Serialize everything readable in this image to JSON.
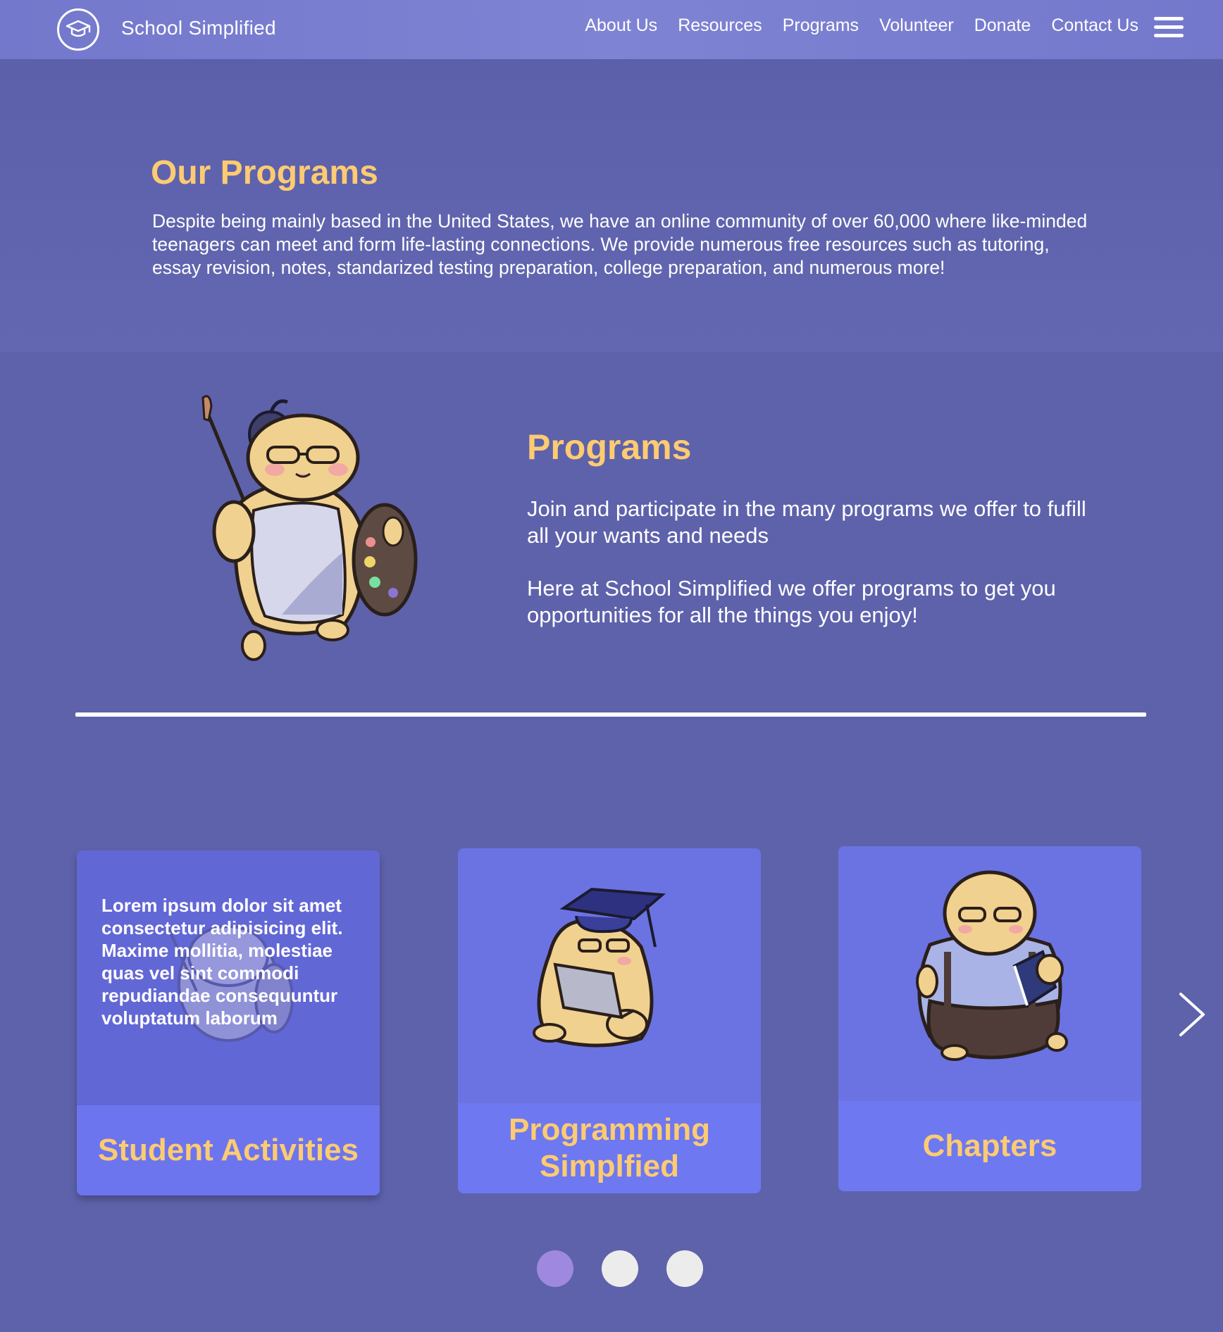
{
  "nav": {
    "brand": "School Simplified",
    "links": [
      "About Us",
      "Resources",
      "Programs",
      "Volunteer",
      "Donate",
      "Contact Us"
    ],
    "logo_icon": "graduation-cap-icon",
    "menu_icon": "hamburger-menu-icon"
  },
  "intro": {
    "title": "Our Programs",
    "body": "Despite being mainly based in the United States, we have an online community of over 60,000 where like-minded teenagers can meet and form life-lasting connections. We provide numerous free resources such as tutoring, essay revision, notes, standarized testing preparation, college preparation, and numerous more!"
  },
  "programs": {
    "title": "Programs",
    "paragraph1": "Join and participate in the many programs we offer to fufill all your wants and needs",
    "paragraph2": "Here at School Simplified we offer programs to get you opportunities for all the things you enjoy!"
  },
  "cards": [
    {
      "title": "Student Activities",
      "hover_text": "Lorem ipsum dolor sit amet consectetur adipisicing elit. Maxime mollitia, molestiae quas vel sint commodi repudiandae consequuntur voluptatum laborum",
      "icon": "artist-mascot-icon"
    },
    {
      "title": "Programming Simplfied",
      "icon": "graduate-laptop-mascot-icon"
    },
    {
      "title": "Chapters",
      "icon": "reading-mascot-icon"
    }
  ],
  "carousel": {
    "next_icon": "chevron-right-icon",
    "dots": 3,
    "active_index": 0
  },
  "colors": {
    "background": "#5e62ab",
    "nav": "#7a7ed0",
    "accent_yellow": "#fccb72",
    "card": "#6b73e3",
    "card_footer": "#6e78f0",
    "dot_active": "#9f89e0",
    "dot_inactive": "#ececec"
  }
}
